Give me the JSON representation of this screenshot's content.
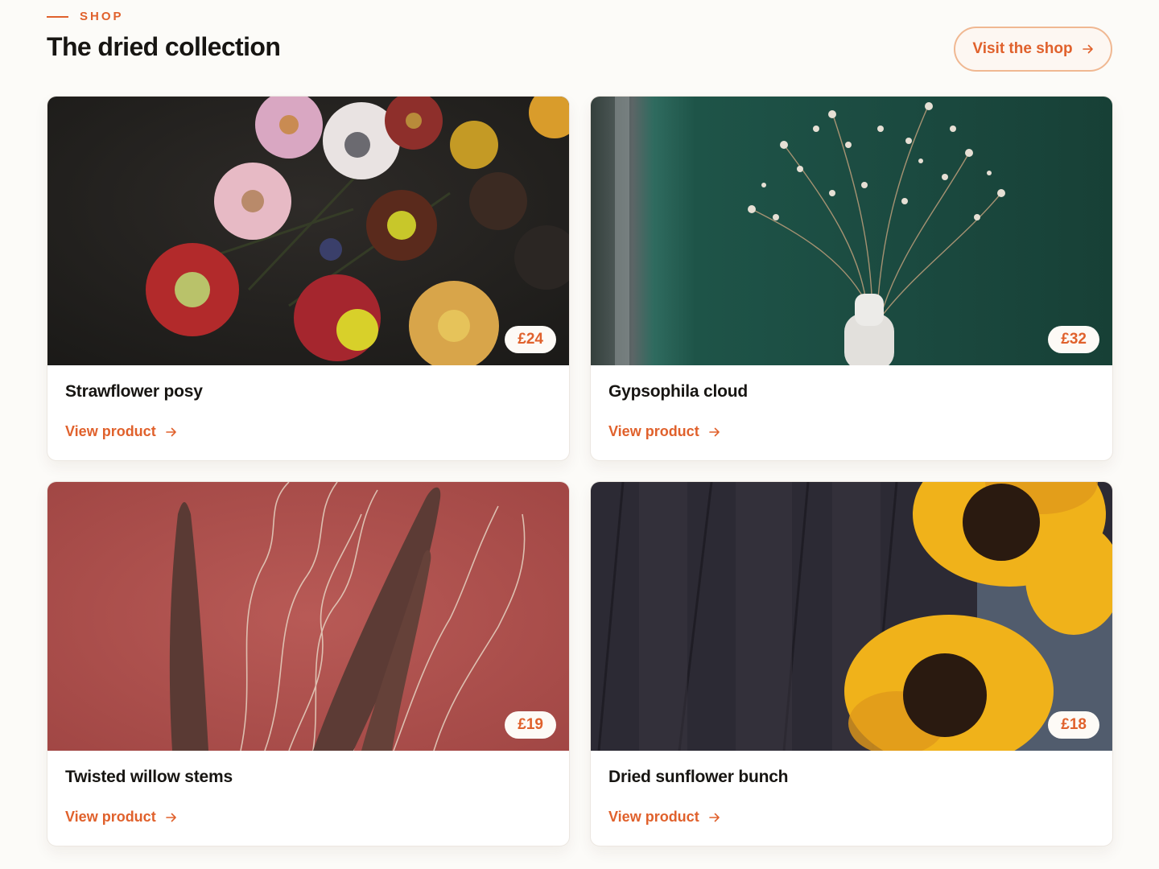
{
  "header": {
    "eyebrow": "SHOP",
    "title": "The dried collection",
    "cta_label": "Visit the shop",
    "cta_icon": "arrow-right-icon"
  },
  "products": [
    {
      "name": "Strawflower posy",
      "price": "£24",
      "link_label": "View product",
      "image": "strawflower-photo"
    },
    {
      "name": "Gypsophila cloud",
      "price": "£32",
      "link_label": "View product",
      "image": "gypsophila-photo"
    },
    {
      "name": "Twisted willow stems",
      "price": "£19",
      "link_label": "View product",
      "image": "willow-photo"
    },
    {
      "name": "Dried sunflower bunch",
      "price": "£18",
      "link_label": "View product",
      "image": "sunflower-photo"
    }
  ],
  "colors": {
    "accent": "#e0612c",
    "background": "#fcfbf8",
    "text": "#171512"
  }
}
